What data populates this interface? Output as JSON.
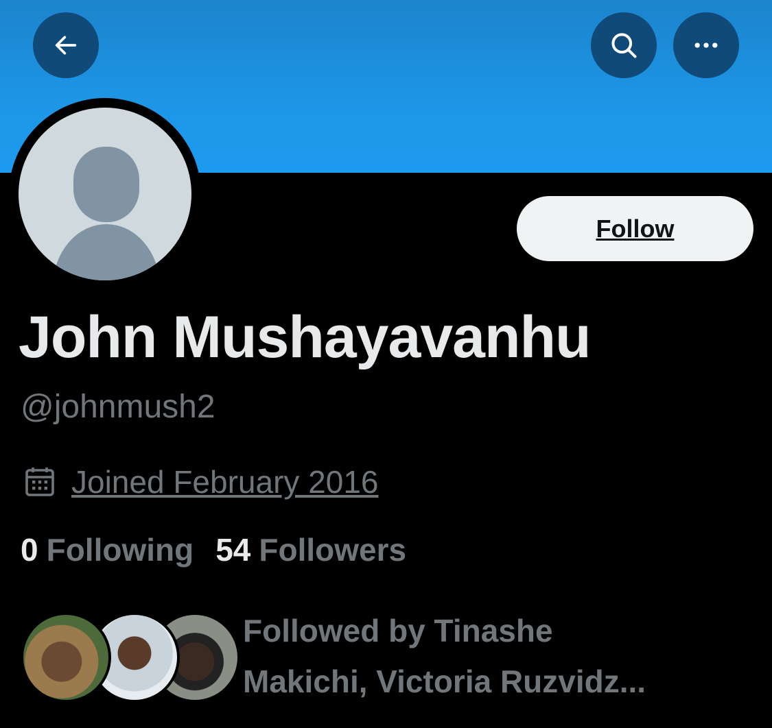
{
  "header": {
    "banner_color": "#1d9bf0",
    "back_icon": "arrow-left-icon",
    "search_icon": "search-icon",
    "more_icon": "more-horizontal-icon"
  },
  "profile": {
    "display_name": "John Mushayavanhu",
    "handle": "@johnmush2",
    "joined": "Joined February 2016",
    "follow_label": "Follow"
  },
  "stats": {
    "following_count": "0",
    "following_label": "Following",
    "followers_count": "54",
    "followers_label": "Followers"
  },
  "followed_by": {
    "line1": "Followed by Tinashe",
    "line2": "Makichi, Victoria Ruzvidz..."
  }
}
